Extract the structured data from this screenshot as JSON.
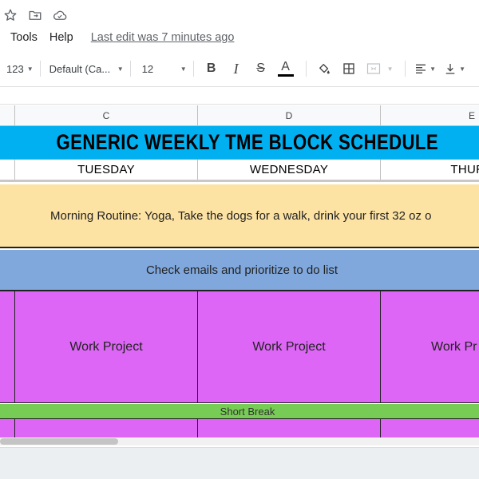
{
  "title_icons": [
    "star-icon",
    "move-to-folder-icon",
    "cloud-status-icon"
  ],
  "menu": {
    "items": [
      "Tools",
      "Help"
    ],
    "last_edit": "Last edit was 7 minutes ago"
  },
  "toolbar": {
    "number_format": "123",
    "font_family": "Default (Ca...",
    "font_size": "12",
    "bold": "B",
    "italic": "I",
    "strike": "S",
    "text_color": "A"
  },
  "columns": [
    "C",
    "D",
    "E"
  ],
  "schedule": {
    "title": "GENERIC WEEKLY TME BLOCK SCHEDULE",
    "days": [
      "TUESDAY",
      "WEDNESDAY",
      "THURS"
    ],
    "morning": "Morning Routine: Yoga, Take the dogs for a walk, drink your first 32 oz o",
    "emails": "Check emails and prioritize to do list",
    "work": [
      "Work Project",
      "Work Project",
      "Work Pr"
    ],
    "short_break": "Short Break"
  },
  "colors": {
    "title_bg": "#00b0f0",
    "morning_bg": "#fde3a3",
    "emails_bg": "#80a8dc",
    "work_bg": "#dd66f6",
    "break_bg": "#77cc55"
  }
}
